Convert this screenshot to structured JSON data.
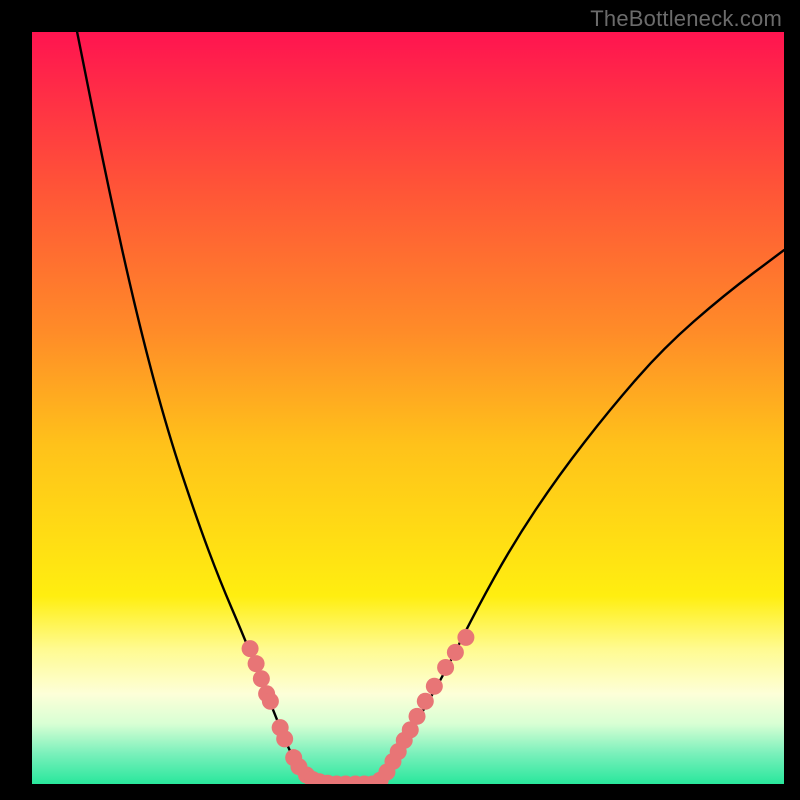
{
  "attribution": "TheBottleneck.com",
  "accent": {
    "marker_color": "#e87576",
    "curve_color": "#000000"
  },
  "gradient_stops": [
    {
      "offset": 0.0,
      "color": "#ff1450"
    },
    {
      "offset": 0.2,
      "color": "#ff5238"
    },
    {
      "offset": 0.4,
      "color": "#ff8c28"
    },
    {
      "offset": 0.55,
      "color": "#ffc21a"
    },
    {
      "offset": 0.75,
      "color": "#ffee10"
    },
    {
      "offset": 0.82,
      "color": "#fffb90"
    },
    {
      "offset": 0.88,
      "color": "#fdffd8"
    },
    {
      "offset": 0.92,
      "color": "#d8ffd4"
    },
    {
      "offset": 0.96,
      "color": "#79f0bb"
    },
    {
      "offset": 1.0,
      "color": "#29e79c"
    }
  ],
  "chart_data": {
    "type": "line",
    "title": "",
    "xlabel": "",
    "ylabel": "",
    "xlim": [
      0,
      100
    ],
    "ylim": [
      0,
      100
    ],
    "series": [
      {
        "name": "left-branch",
        "x": [
          6,
          10,
          14,
          18,
          22,
          25,
          28,
          30,
          32,
          34,
          35,
          36,
          37,
          38
        ],
        "y": [
          100,
          80,
          62,
          47,
          35,
          27,
          20,
          15,
          10,
          5,
          3,
          2,
          1,
          0
        ]
      },
      {
        "name": "valley",
        "x": [
          38,
          40,
          42,
          44,
          46
        ],
        "y": [
          0,
          0,
          0,
          0,
          0
        ]
      },
      {
        "name": "right-branch",
        "x": [
          46,
          48,
          51,
          55,
          59,
          64,
          70,
          77,
          84,
          92,
          100
        ],
        "y": [
          0,
          3,
          8,
          15,
          23,
          32,
          41,
          50,
          58,
          65,
          71
        ]
      }
    ],
    "markers": {
      "name": "data-points",
      "points": [
        {
          "x": 29.0,
          "y": 18.0
        },
        {
          "x": 29.8,
          "y": 16.0
        },
        {
          "x": 30.5,
          "y": 14.0
        },
        {
          "x": 31.2,
          "y": 12.0
        },
        {
          "x": 31.7,
          "y": 11.0
        },
        {
          "x": 33.0,
          "y": 7.5
        },
        {
          "x": 33.6,
          "y": 6.0
        },
        {
          "x": 34.8,
          "y": 3.5
        },
        {
          "x": 35.5,
          "y": 2.3
        },
        {
          "x": 36.5,
          "y": 1.2
        },
        {
          "x": 37.3,
          "y": 0.6
        },
        {
          "x": 38.2,
          "y": 0.3
        },
        {
          "x": 39.3,
          "y": 0.1
        },
        {
          "x": 40.5,
          "y": 0.0
        },
        {
          "x": 41.7,
          "y": 0.0
        },
        {
          "x": 43.0,
          "y": 0.0
        },
        {
          "x": 44.2,
          "y": 0.0
        },
        {
          "x": 45.3,
          "y": 0.0
        },
        {
          "x": 46.3,
          "y": 0.5
        },
        {
          "x": 47.2,
          "y": 1.6
        },
        {
          "x": 48.0,
          "y": 3.0
        },
        {
          "x": 48.7,
          "y": 4.3
        },
        {
          "x": 49.5,
          "y": 5.8
        },
        {
          "x": 50.3,
          "y": 7.2
        },
        {
          "x": 51.2,
          "y": 9.0
        },
        {
          "x": 52.3,
          "y": 11.0
        },
        {
          "x": 53.5,
          "y": 13.0
        },
        {
          "x": 55.0,
          "y": 15.5
        },
        {
          "x": 56.3,
          "y": 17.5
        },
        {
          "x": 57.7,
          "y": 19.5
        }
      ]
    }
  }
}
